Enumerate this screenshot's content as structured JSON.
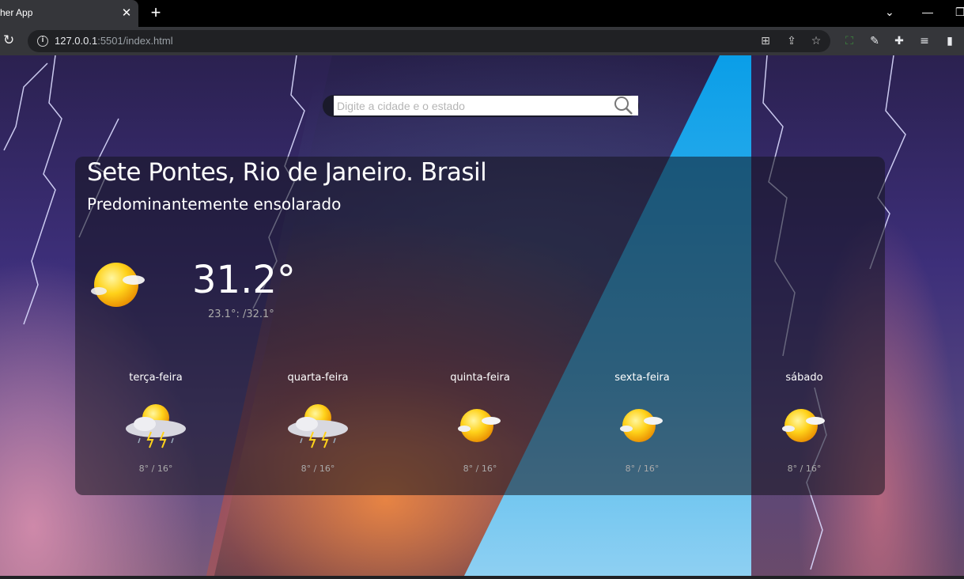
{
  "browser": {
    "tab_title": "her App",
    "tab_close": "✕",
    "new_tab": "+",
    "url_host": "127.0.0.1",
    "url_rest": ":5501/index.html"
  },
  "search": {
    "placeholder": "Digite a cidade e o estado"
  },
  "weather": {
    "city": "Sete Pontes, Rio de Janeiro. Brasil",
    "description": "Predominantemente ensolarado",
    "temperature": "31.2°",
    "min_max": "23.1°: /32.1°",
    "icon": "sun-cloud-icon"
  },
  "forecast": [
    {
      "day": "terça-feira",
      "range": "8° / 16°",
      "icon": "thunderstorm-icon"
    },
    {
      "day": "quarta-feira",
      "range": "8° / 16°",
      "icon": "thunderstorm-icon"
    },
    {
      "day": "quinta-feira",
      "range": "8° / 16°",
      "icon": "sun-cloud-icon"
    },
    {
      "day": "sexta-feira",
      "range": "8° / 16°",
      "icon": "sun-cloud-icon"
    },
    {
      "day": "sábado",
      "range": "8° / 16°",
      "icon": "sun-cloud-icon"
    }
  ],
  "colors": {
    "sky_day": "#0a9ee8",
    "storm": "#3d2f7a",
    "card_overlay": "#14141e"
  }
}
